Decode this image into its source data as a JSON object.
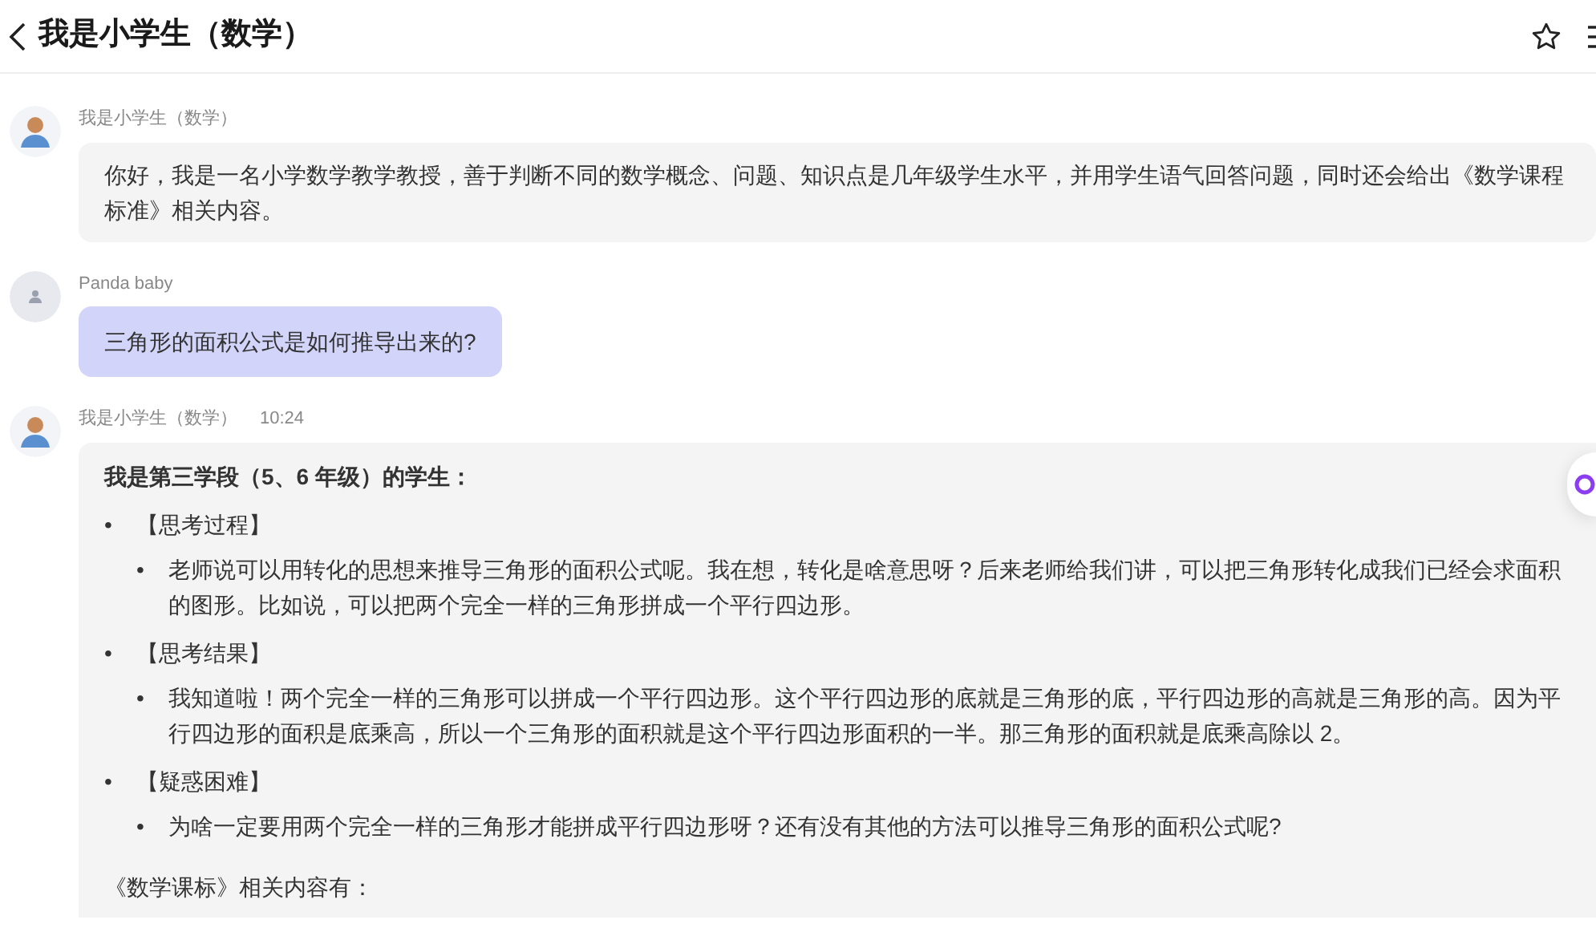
{
  "header": {
    "title": "我是小学生（数学）"
  },
  "messages": [
    {
      "from_user": false,
      "sender": "我是小学生（数学）",
      "kind": "text",
      "text": "你好，我是一名小学数学教学教授，善于判断不同的数学概念、问题、知识点是几年级学生水平，并用学生语气回答问题，同时还会给出《数学课程标准》相关内容。"
    },
    {
      "from_user": true,
      "sender": "Panda baby",
      "kind": "text",
      "text": "三角形的面积公式是如何推导出来的?"
    },
    {
      "from_user": false,
      "sender": "我是小学生（数学）",
      "time": "10:24",
      "kind": "rich",
      "heading": "我是第三学段（5、6 年级）的学生：",
      "sections": [
        {
          "bullet": "•",
          "title": "【思考过程】",
          "items": [
            {
              "bullet": "•",
              "text": "老师说可以用转化的思想来推导三角形的面积公式呢。我在想，转化是啥意思呀？后来老师给我们讲，可以把三角形转化成我们已经会求面积的图形。比如说，可以把两个完全一样的三角形拼成一个平行四边形。"
            }
          ]
        },
        {
          "bullet": "•",
          "title": "【思考结果】",
          "items": [
            {
              "bullet": "•",
              "text": "我知道啦！两个完全一样的三角形可以拼成一个平行四边形。这个平行四边形的底就是三角形的底，平行四边形的高就是三角形的高。因为平行四边形的面积是底乘高，所以一个三角形的面积就是这个平行四边形面积的一半。那三角形的面积就是底乘高除以 2。"
            }
          ]
        },
        {
          "bullet": "•",
          "title": "【疑惑困难】",
          "items": [
            {
              "bullet": "•",
              "text": "为啥一定要用两个完全一样的三角形才能拼成平行四边形呀？还有没有其他的方法可以推导三角形的面积公式呢?"
            }
          ]
        }
      ],
      "footer": "《数学课标》相关内容有："
    }
  ]
}
